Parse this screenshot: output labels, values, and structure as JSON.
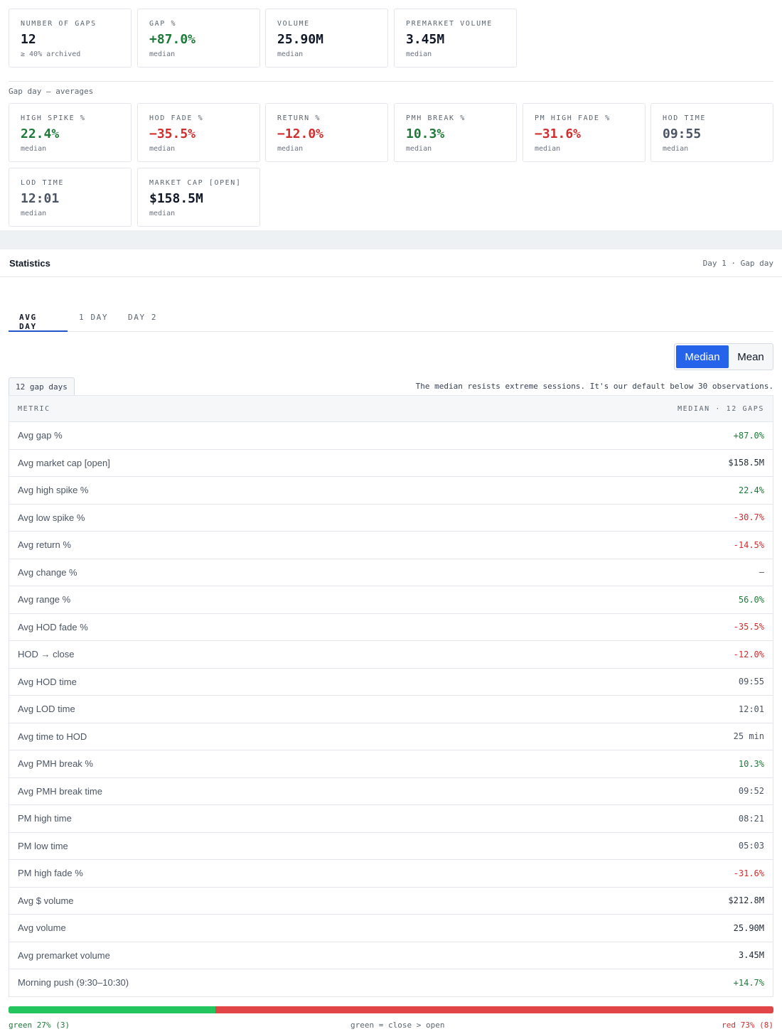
{
  "summary_cards": [
    {
      "label": "NUMBER OF GAPS",
      "value": "12",
      "sub": "≥ 40% archived",
      "tone": "neutral"
    },
    {
      "label": "GAP %",
      "value": "+87.0%",
      "sub": "median",
      "tone": "pos"
    },
    {
      "label": "VOLUME",
      "value": "25.90M",
      "sub": "median",
      "tone": "neutral"
    },
    {
      "label": "PREMARKET VOLUME",
      "value": "3.45M",
      "sub": "median",
      "tone": "neutral"
    }
  ],
  "gap_day_caption": "Gap day — averages",
  "gap_day_cards": [
    {
      "label": "HIGH SPIKE %",
      "value": "22.4%",
      "sub": "median",
      "tone": "pos"
    },
    {
      "label": "HOD FADE %",
      "value": "−35.5%",
      "sub": "median",
      "tone": "neg"
    },
    {
      "label": "RETURN %",
      "value": "−12.0%",
      "sub": "median",
      "tone": "neg"
    },
    {
      "label": "PMH BREAK %",
      "value": "10.3%",
      "sub": "median",
      "tone": "pos"
    },
    {
      "label": "PM HIGH FADE %",
      "value": "−31.6%",
      "sub": "median",
      "tone": "neg"
    },
    {
      "label": "HOD TIME",
      "value": "09:55",
      "sub": "median",
      "tone": "gray"
    },
    {
      "label": "LOD TIME",
      "value": "12:01",
      "sub": "median",
      "tone": "gray"
    },
    {
      "label": "MARKET CAP [OPEN]",
      "value": "$158.5M",
      "sub": "median",
      "tone": "neutral"
    }
  ],
  "statistics": {
    "title": "Statistics",
    "meta": "Day 1 · Gap day",
    "tabs": [
      "AVG DAY",
      "1 DAY",
      "DAY 2"
    ],
    "active_tab": "AVG DAY",
    "toggle": {
      "median": "Median",
      "mean": "Mean",
      "selected": "Median"
    },
    "gap_days": "12 gap days",
    "note": "The median resists extreme sessions. It's our default below 30 observations.",
    "table": {
      "col_metric": "METRIC",
      "col_value": "MEDIAN · 12 GAPS",
      "rows": [
        {
          "metric": "Avg gap %",
          "value": "+87.0%",
          "tone": "pos"
        },
        {
          "metric": "Avg market cap [open]",
          "value": "$158.5M",
          "tone": "neutral"
        },
        {
          "metric": "Avg high spike %",
          "value": "22.4%",
          "tone": "pos"
        },
        {
          "metric": "Avg low spike %",
          "value": "-30.7%",
          "tone": "neg"
        },
        {
          "metric": "Avg return %",
          "value": "-14.5%",
          "tone": "neg"
        },
        {
          "metric": "Avg change %",
          "value": "—",
          "tone": "gray"
        },
        {
          "metric": "Avg range %",
          "value": "56.0%",
          "tone": "pos"
        },
        {
          "metric": "Avg HOD fade %",
          "value": "-35.5%",
          "tone": "neg"
        },
        {
          "metric": "HOD → close",
          "value": "-12.0%",
          "tone": "neg"
        },
        {
          "metric": "Avg HOD time",
          "value": "09:55",
          "tone": "gray"
        },
        {
          "metric": "Avg LOD time",
          "value": "12:01",
          "tone": "gray"
        },
        {
          "metric": "Avg time to HOD",
          "value": "25 min",
          "tone": "gray"
        },
        {
          "metric": "Avg PMH break %",
          "value": "10.3%",
          "tone": "pos"
        },
        {
          "metric": "Avg PMH break time",
          "value": "09:52",
          "tone": "gray"
        },
        {
          "metric": "PM high time",
          "value": "08:21",
          "tone": "gray"
        },
        {
          "metric": "PM low time",
          "value": "05:03",
          "tone": "gray"
        },
        {
          "metric": "PM high fade %",
          "value": "-31.6%",
          "tone": "neg"
        },
        {
          "metric": "Avg $ volume",
          "value": "$212.8M",
          "tone": "neutral"
        },
        {
          "metric": "Avg volume",
          "value": "25.90M",
          "tone": "neutral"
        },
        {
          "metric": "Avg premarket volume",
          "value": "3.45M",
          "tone": "neutral"
        },
        {
          "metric": "Morning push (9:30–10:30)",
          "value": "+14.7%",
          "tone": "pos"
        }
      ]
    },
    "green_red": {
      "green_fraction": 0.27,
      "left": "green 27% (3)",
      "middle": "green = close > open",
      "right": "red 73% (8)",
      "green_color": "#22c55e",
      "red_color": "#e24545"
    }
  }
}
